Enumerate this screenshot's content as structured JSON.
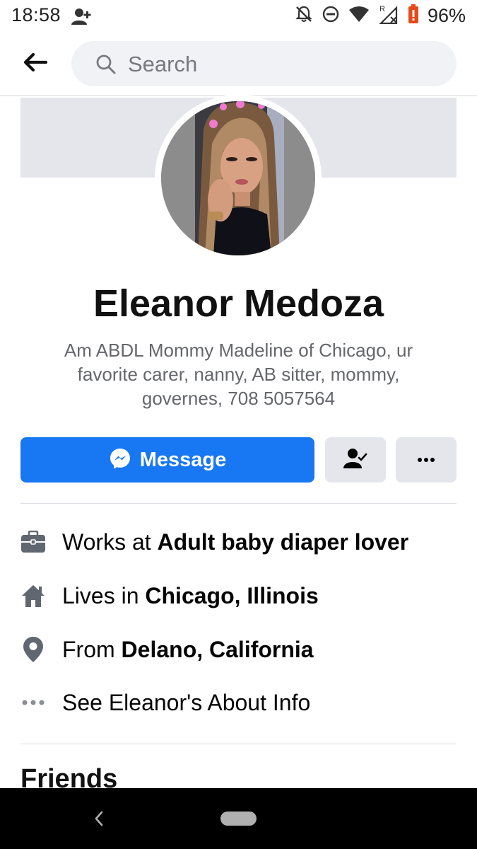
{
  "status_bar": {
    "time": "18:58",
    "battery": "96%",
    "icons": [
      "add-person-icon",
      "silent-bell-icon",
      "do-not-disturb-icon",
      "wifi-icon",
      "signal-roaming-icon",
      "battery-icon"
    ]
  },
  "top_bar": {
    "search_placeholder": "Search",
    "back_icon": "back-arrow-icon"
  },
  "profile": {
    "name": "Eleanor Medoza",
    "bio_lines": [
      "Am ABDL Mommy Madeline of Chicago, ur",
      "favorite carer, nanny, AB sitter, mommy,",
      "governes, 708 5057564"
    ]
  },
  "actions": {
    "message_label": "Message",
    "message_icon": "messenger-icon",
    "friend_icon": "friends-check-icon",
    "more_icon": "more-icon"
  },
  "info": [
    {
      "icon": "briefcase-icon",
      "prefix": "Works at ",
      "value": "Adult baby diaper lover"
    },
    {
      "icon": "home-icon",
      "prefix": "Lives in ",
      "value": "Chicago, Illinois"
    },
    {
      "icon": "location-pin-icon",
      "prefix": "From ",
      "value": "Delano, California"
    },
    {
      "icon": "more-icon",
      "prefix": "See Eleanor's About Info",
      "value": ""
    }
  ],
  "friends_heading": "Friends",
  "colors": {
    "accent": "#1877f2",
    "secondary_button": "#e4e6eb",
    "muted_text": "#65676b"
  }
}
